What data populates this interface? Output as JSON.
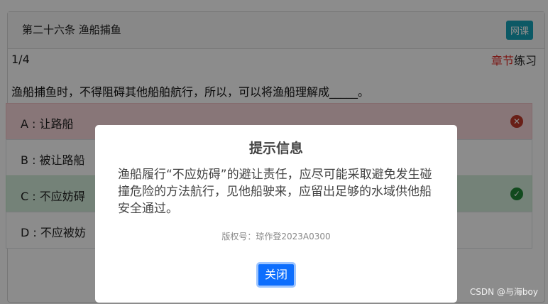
{
  "header": {
    "title": "第二十六条 渔船捕鱼",
    "badge": "网课"
  },
  "progress": "1/4",
  "practice_link": {
    "part1": "章节",
    "part2": "练习"
  },
  "question": "渔船捕鱼时，不得阻碍其他船舶航行，所以，可以将渔船理解成_____。",
  "options": [
    {
      "label": "A : 让路船",
      "state": "wrong"
    },
    {
      "label": "B : 被让路船",
      "state": "normal"
    },
    {
      "label": "C : 不应妨碍",
      "state": "correct"
    },
    {
      "label": "D : 不应被妨",
      "state": "normal"
    }
  ],
  "dialog": {
    "title": "提示信息",
    "body": "渔船履行“不应妨碍”的避让责任，应尽可能采取避免发生碰撞危险的方法航行，见他船驶来，应留出足够的水域供他船安全通过。",
    "copyright": "版权号：琼作登2023A0300",
    "close_label": "关闭"
  },
  "footer_credit": "CSDN @与海boy",
  "colors": {
    "primary": "#0d6efd",
    "wrong_bg": "#f8d7da",
    "correct_bg": "#d4edda",
    "badge": "#17a2b8",
    "accent_red": "#e0302b"
  },
  "icons": {
    "wrong": "x-circle-icon",
    "correct": "check-circle-icon"
  }
}
